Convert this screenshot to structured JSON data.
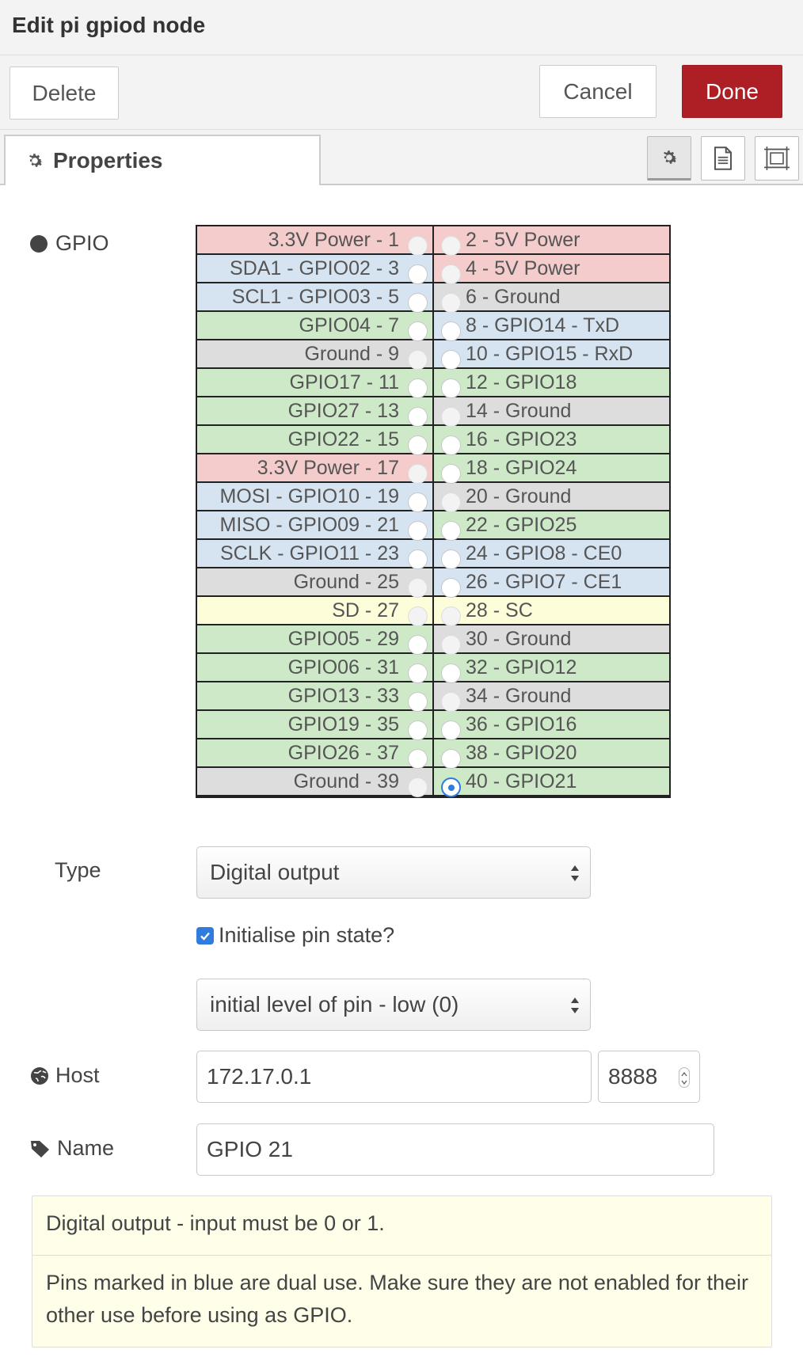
{
  "titlebar": {
    "title": "Edit pi gpiod node"
  },
  "toolbar": {
    "delete_label": "Delete",
    "cancel_label": "Cancel",
    "done_label": "Done"
  },
  "tabs": {
    "properties_label": "Properties"
  },
  "gpio": {
    "label": "GPIO",
    "rows": [
      {
        "left": "3.3V Power - 1",
        "right": "2 - 5V Power",
        "left_color": "#f4cccc",
        "right_color": "#f4cccc"
      },
      {
        "left": "SDA1 - GPIO02 - 3",
        "right": "4 - 5V Power",
        "left_color": "#d6e4f2",
        "right_color": "#f4cccc"
      },
      {
        "left": "SCL1 - GPIO03 - 5",
        "right": "6 - Ground",
        "left_color": "#d6e4f2",
        "right_color": "#dddddd"
      },
      {
        "left": "GPIO04 - 7",
        "right": "8 - GPIO14 - TxD",
        "left_color": "#cde9c8",
        "right_color": "#d6e4f2"
      },
      {
        "left": "Ground - 9",
        "right": "10 - GPIO15 - RxD",
        "left_color": "#dddddd",
        "right_color": "#d6e4f2"
      },
      {
        "left": "GPIO17 - 11",
        "right": "12 - GPIO18",
        "left_color": "#cde9c8",
        "right_color": "#cde9c8"
      },
      {
        "left": "GPIO27 - 13",
        "right": "14 - Ground",
        "left_color": "#cde9c8",
        "right_color": "#dddddd"
      },
      {
        "left": "GPIO22 - 15",
        "right": "16 - GPIO23",
        "left_color": "#cde9c8",
        "right_color": "#cde9c8"
      },
      {
        "left": "3.3V Power - 17",
        "right": "18 - GPIO24",
        "left_color": "#f4cccc",
        "right_color": "#cde9c8"
      },
      {
        "left": "MOSI - GPIO10 - 19",
        "right": "20 - Ground",
        "left_color": "#d6e4f2",
        "right_color": "#dddddd"
      },
      {
        "left": "MISO - GPIO09 - 21",
        "right": "22 - GPIO25",
        "left_color": "#d6e4f2",
        "right_color": "#cde9c8"
      },
      {
        "left": "SCLK - GPIO11 - 23",
        "right": "24 - GPIO8 - CE0",
        "left_color": "#d6e4f2",
        "right_color": "#d6e4f2"
      },
      {
        "left": "Ground - 25",
        "right": "26 - GPIO7 - CE1",
        "left_color": "#dddddd",
        "right_color": "#d6e4f2"
      },
      {
        "left": "SD - 27",
        "right": "28 - SC",
        "left_color": "#fdfdd9",
        "right_color": "#fdfdd9"
      },
      {
        "left": "GPIO05 - 29",
        "right": "30 - Ground",
        "left_color": "#cde9c8",
        "right_color": "#dddddd"
      },
      {
        "left": "GPIO06 - 31",
        "right": "32 - GPIO12",
        "left_color": "#cde9c8",
        "right_color": "#cde9c8"
      },
      {
        "left": "GPIO13 - 33",
        "right": "34 - Ground",
        "left_color": "#cde9c8",
        "right_color": "#dddddd"
      },
      {
        "left": "GPIO19 - 35",
        "right": "36 - GPIO16",
        "left_color": "#cde9c8",
        "right_color": "#cde9c8"
      },
      {
        "left": "GPIO26 - 37",
        "right": "38 - GPIO20",
        "left_color": "#cde9c8",
        "right_color": "#cde9c8"
      },
      {
        "left": "Ground - 39",
        "right": "40 - GPIO21",
        "left_color": "#dddddd",
        "right_color": "#cde9c8"
      }
    ],
    "selected_pin": "40 - GPIO21"
  },
  "type": {
    "label": "Type",
    "value": "Digital output"
  },
  "initialise": {
    "label": "Initialise pin state?",
    "checked": true
  },
  "initial_level": {
    "value": "initial level of pin - low (0)"
  },
  "host": {
    "label": "Host",
    "value": "172.17.0.1",
    "port": "8888"
  },
  "name": {
    "label": "Name",
    "value": "GPIO 21"
  },
  "help": {
    "line1": "Digital output - input must be 0 or 1.",
    "line2": "Pins marked in blue are dual use. Make sure they are not enabled for their other use before using as GPIO."
  },
  "colors": {
    "done": "#ad1f25",
    "accent": "#2f7bde"
  }
}
